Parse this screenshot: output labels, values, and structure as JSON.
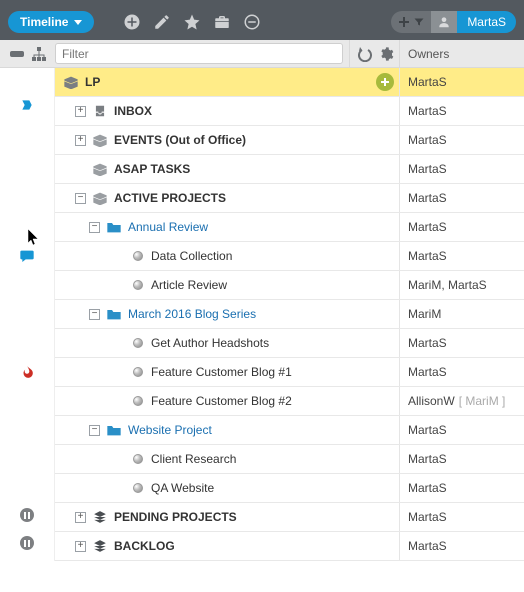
{
  "header": {
    "timeline_label": "Timeline",
    "user_name": "MartaS"
  },
  "subbar": {
    "filter_placeholder": "Filter",
    "owners_label": "Owners"
  },
  "tree": {
    "root": {
      "label": "LP",
      "owner": "MartaS"
    },
    "rows": [
      {
        "id": "inbox",
        "label": "INBOX",
        "owner": "MartaS"
      },
      {
        "id": "events",
        "label": "EVENTS (Out of Office)",
        "owner": "MartaS"
      },
      {
        "id": "asap",
        "label": "ASAP TASKS",
        "owner": "MartaS"
      },
      {
        "id": "active",
        "label": "ACTIVE PROJECTS",
        "owner": "MartaS"
      },
      {
        "id": "annual",
        "label": "Annual Review",
        "owner": "MartaS"
      },
      {
        "id": "datacol",
        "label": "Data Collection",
        "owner": "MartaS"
      },
      {
        "id": "artrev",
        "label": "Article Review",
        "owner": "MariM, MartaS"
      },
      {
        "id": "march",
        "label": "March 2016 Blog Series",
        "owner": "MariM"
      },
      {
        "id": "headshots",
        "label": "Get Author Headshots",
        "owner": "MartaS"
      },
      {
        "id": "fcb1",
        "label": "Feature Customer Blog #1",
        "owner": "MartaS"
      },
      {
        "id": "fcb2",
        "label": "Feature Customer Blog #2",
        "owner": "AllisonW",
        "owner_dim": "[ MariM ]"
      },
      {
        "id": "website",
        "label": "Website Project",
        "owner": "MartaS"
      },
      {
        "id": "client",
        "label": "Client Research",
        "owner": "MartaS"
      },
      {
        "id": "qa",
        "label": "QA Website",
        "owner": "MartaS"
      },
      {
        "id": "pending",
        "label": "PENDING PROJECTS",
        "owner": "MartaS"
      },
      {
        "id": "backlog",
        "label": "BACKLOG",
        "owner": "MartaS"
      }
    ]
  }
}
